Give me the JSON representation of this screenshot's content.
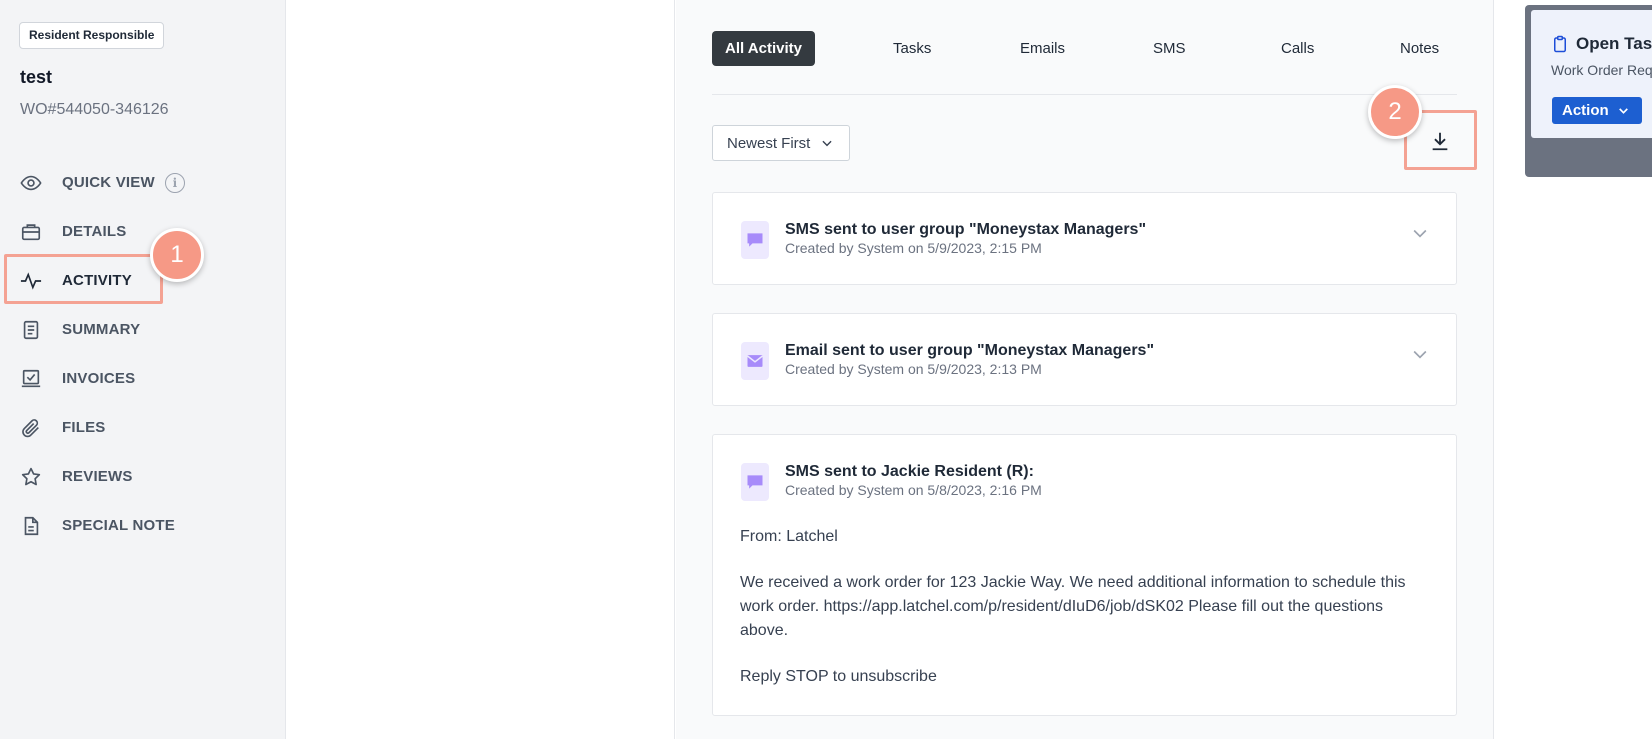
{
  "sidebar": {
    "badge": "Resident Responsible",
    "title": "test",
    "wo_number": "WO#544050-346126",
    "items": [
      {
        "label": "QUICK VIEW",
        "icon": "eye-icon"
      },
      {
        "label": "DETAILS",
        "icon": "briefcase-icon"
      },
      {
        "label": "ACTIVITY",
        "icon": "activity-icon"
      },
      {
        "label": "SUMMARY",
        "icon": "document-icon"
      },
      {
        "label": "INVOICES",
        "icon": "invoice-icon"
      },
      {
        "label": "FILES",
        "icon": "paperclip-icon"
      },
      {
        "label": "REVIEWS",
        "icon": "star-icon"
      },
      {
        "label": "SPECIAL NOTE",
        "icon": "note-icon"
      }
    ],
    "quick_view_info_glyph": "i"
  },
  "callouts": {
    "first": "1",
    "second": "2"
  },
  "activity": {
    "tabs": [
      "All Activity",
      "Tasks",
      "Emails",
      "SMS",
      "Calls",
      "Notes"
    ],
    "active_tab": "All Activity",
    "sort_label": "Newest First",
    "entries": [
      {
        "type": "sms",
        "icon": "message-icon",
        "title": "SMS sent to user group \"Moneystax Managers\"",
        "subtitle": "Created by System on 5/9/2023, 2:15 PM"
      },
      {
        "type": "email",
        "icon": "mail-icon",
        "title": "Email sent to user group \"Moneystax Managers\"",
        "subtitle": "Created by System on 5/9/2023, 2:13 PM"
      },
      {
        "type": "sms",
        "icon": "message-icon",
        "title": "SMS sent to Jackie Resident (R):",
        "subtitle": "Created by System on 5/8/2023, 2:16 PM",
        "body_from": "From: Latchel",
        "body_message": "We received a work order for 123 Jackie Way. We need additional information to schedule this work order. https://app.latchel.com/p/resident/dIuD6/job/dSK02 Please fill out the questions above.",
        "body_footer": "Reply STOP to unsubscribe"
      }
    ]
  },
  "task_panel": {
    "title": "Open Task:",
    "subtitle": "Work Order Req",
    "action_label": "Action"
  },
  "colors": {
    "accent_blue": "#1d5fd1",
    "highlight": "#f4a293",
    "callout": "#f69986",
    "tab_active_bg": "#343a40",
    "message_icon": "#a78bfa"
  }
}
